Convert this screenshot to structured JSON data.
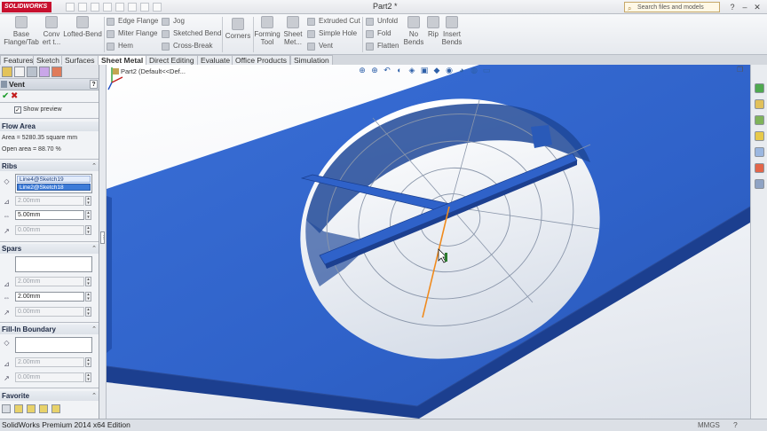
{
  "titlebar": {
    "brand": "SOLIDWORKS",
    "doc_title": "Part2 *",
    "search_placeholder": "Search files and models",
    "win_minimize": "–",
    "win_restore": "❐",
    "win_close": "✕"
  },
  "ribbon": {
    "big": [
      {
        "label": "Base\nFlange/Tab"
      },
      {
        "label": "Conv\nert t..."
      },
      {
        "label": "Lofted-Bend"
      },
      {
        "label": "Corners"
      },
      {
        "label": "Forming\nTool"
      },
      {
        "label": "Sheet\nMet..."
      },
      {
        "label": "No\nBends"
      },
      {
        "label": "Rip"
      },
      {
        "label": "Insert\nBends"
      }
    ],
    "small": {
      "edge_flange": "Edge Flange",
      "miter_flange": "Miter Flange",
      "hem": "Hem",
      "jog": "Jog",
      "sketched_bend": "Sketched Bend",
      "cross_break": "Cross-Break",
      "extruded_cut": "Extruded Cut",
      "simple_hole": "Simple Hole",
      "vent": "Vent",
      "unfold": "Unfold",
      "fold": "Fold",
      "flatten": "Flatten"
    }
  },
  "tabs": [
    "Features",
    "Sketch",
    "Surfaces",
    "Sheet Metal",
    "Direct Editing",
    "Evaluate",
    "Office Products",
    "Simulation"
  ],
  "property_manager": {
    "title": "Vent",
    "help": "?",
    "ok": "✔",
    "cancel": "✖",
    "show_preview": "Show preview",
    "flow_area": {
      "header": "Flow Area",
      "area": "Area = 5280.35 square mm",
      "open_area": "Open area = 88.70 %"
    },
    "ribs": {
      "header": "Ribs",
      "items": [
        "Line4@Sketch19",
        "Line2@Sketch18"
      ],
      "depth": "2.00mm",
      "width": "5.00mm",
      "offset": "0.00mm"
    },
    "spars": {
      "header": "Spars",
      "depth": "2.00mm",
      "width": "2.00mm",
      "offset": "0.00mm"
    },
    "fill_in": {
      "header": "Fill-In Boundary",
      "depth": "2.00mm",
      "offset": "0.00mm"
    },
    "favorite": {
      "header": "Favorite"
    }
  },
  "viewport": {
    "tree_crumb": "Part2  (Default<<Def..."
  },
  "statusbar": {
    "text": "SolidWorks Premium 2014 x64 Edition",
    "units": "MMGS",
    "help": "?"
  },
  "colors": {
    "part_blue": "#2f62c9",
    "part_dark": "#1c3f8f",
    "accent_orange": "#f08a1c"
  }
}
